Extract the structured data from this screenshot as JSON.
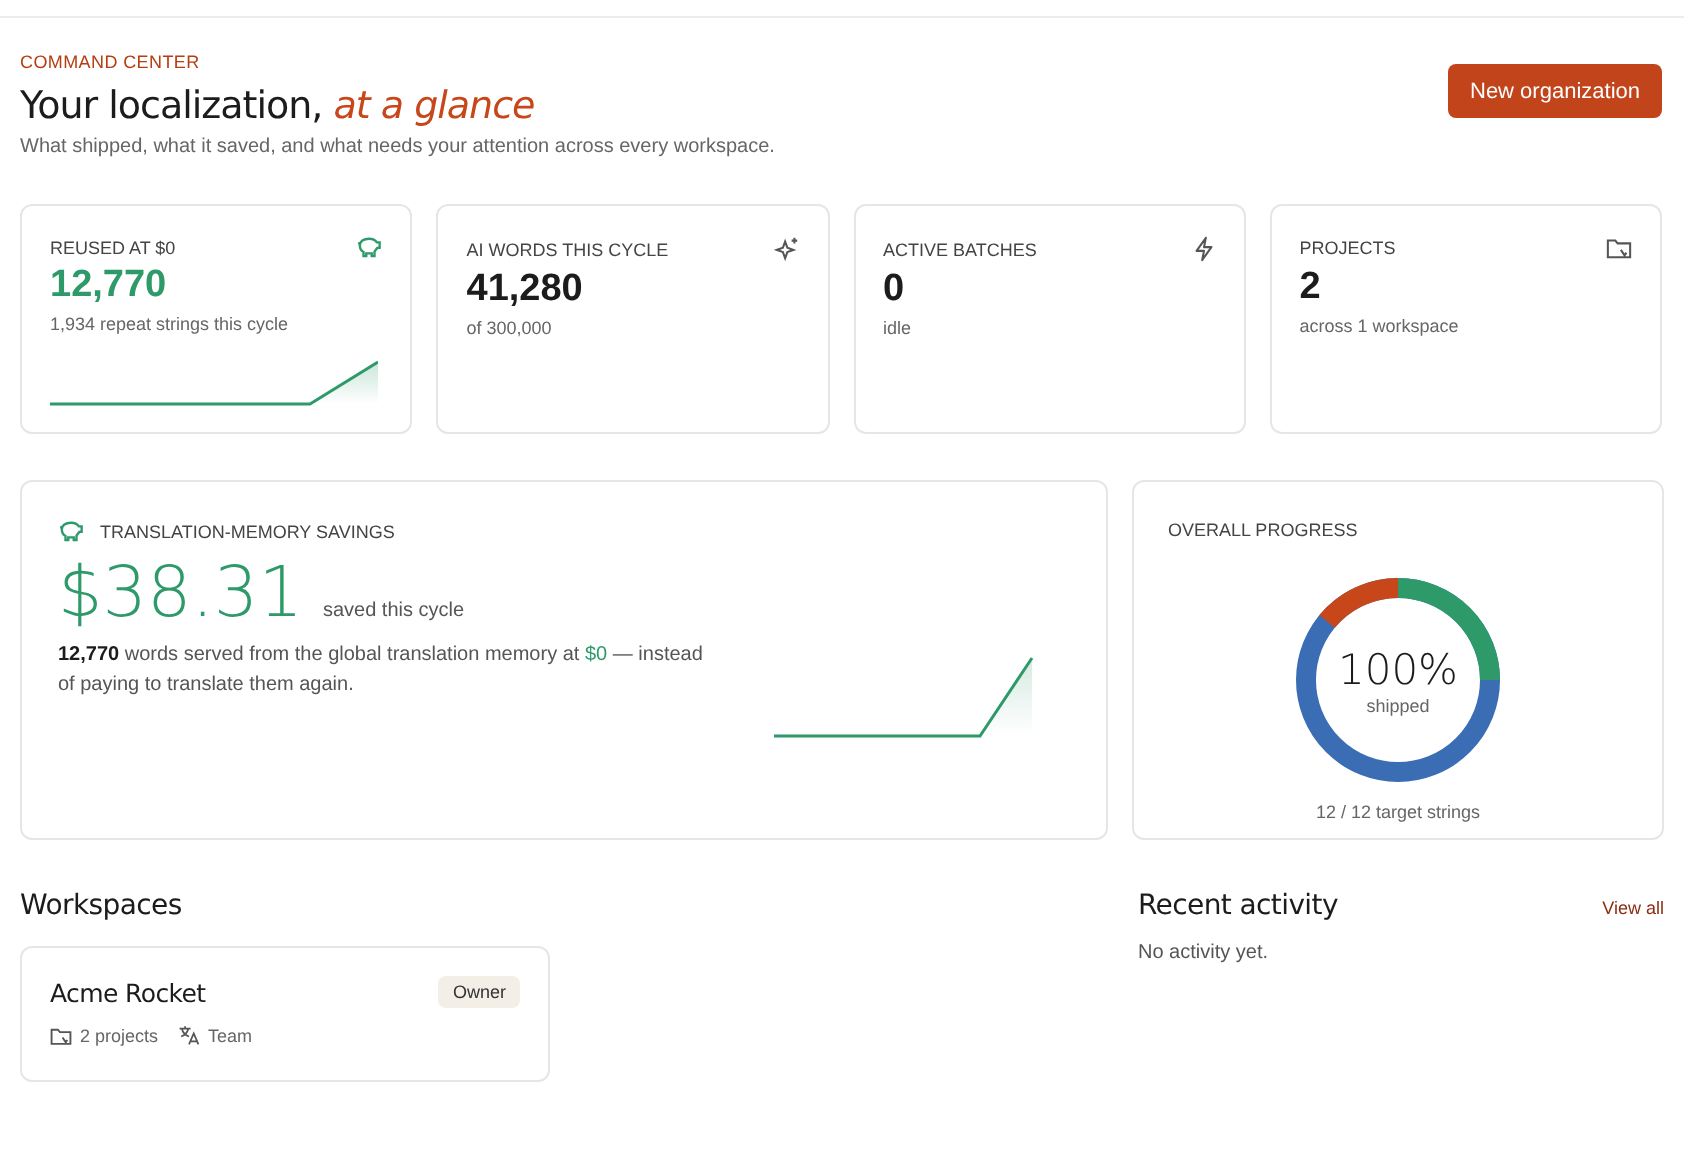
{
  "header": {
    "eyebrow": "COMMAND CENTER",
    "title": "Your localization,",
    "title_accent": "at a glance",
    "subtitle": "What shipped, what it saved, and what needs your attention across every workspace.",
    "button": "New organization"
  },
  "stats": [
    {
      "label": "REUSED AT $0",
      "value": "12,770",
      "caption": "1,934 repeat strings this cycle",
      "kind": "savings"
    },
    {
      "label": "AI WORDS THIS CYCLE",
      "value": "41,280",
      "caption": "of 300,000",
      "kind": "ai"
    },
    {
      "label": "ACTIVE BATCHES",
      "value": "0",
      "caption": "idle",
      "kind": "batches"
    },
    {
      "label": "PROJECTS",
      "value": "2",
      "caption": "across 1 workspace",
      "kind": "projects"
    }
  ],
  "savings": {
    "label": "TRANSLATION-MEMORY SAVINGS",
    "amount": "$38.31",
    "amount_caption": "saved this cycle",
    "description": "**12,770** words served from the global translation memory at $0 — instead of paying to translate them again."
  },
  "progress": {
    "label": "OVERALL PROGRESS",
    "percent": "100%",
    "percent_caption": "shipped",
    "caption": "12 / 12 target strings"
  },
  "workspaces": {
    "heading": "Workspaces",
    "items": [
      {
        "name": "Acme Rocket",
        "role": "Owner",
        "projects": "2 projects",
        "plan": "Team"
      }
    ]
  },
  "activity": {
    "heading": "Recent activity",
    "link": "View all",
    "empty": "No activity yet."
  }
}
